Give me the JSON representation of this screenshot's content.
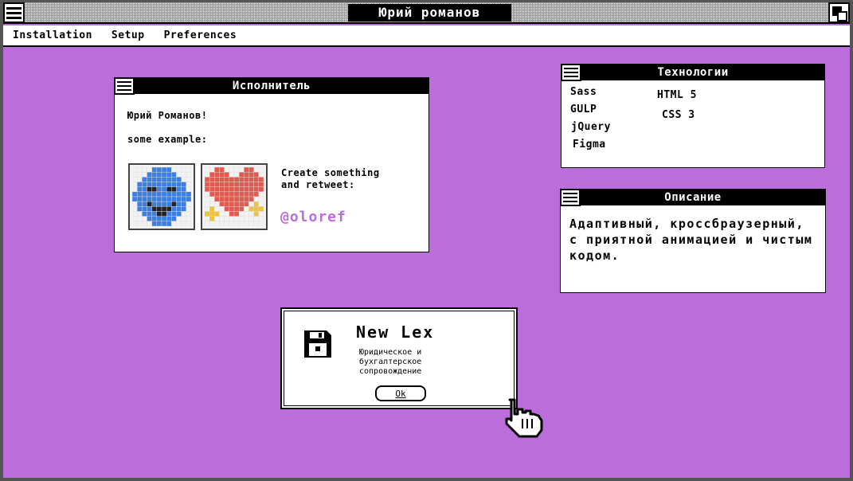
{
  "window": {
    "title": "Юрий романов"
  },
  "menu": [
    "Installation",
    "Setup",
    "Preferences"
  ],
  "artist_window": {
    "title": "Исполнитель",
    "name_line": "Юрий Романов!",
    "example_line": "some example:",
    "tweet_line1": "Create something",
    "tweet_line2": "and retweet:",
    "handle": "@oloref"
  },
  "tech_window": {
    "title": "Технологии",
    "items": [
      "Sass",
      "GULP",
      "jQuery",
      "Figma",
      "HTML 5",
      "CSS 3"
    ]
  },
  "desc_window": {
    "title": "Описание",
    "text": "Адаптивный, кроссбраузерный, с приятной анимацией и чистым кодом."
  },
  "dialog": {
    "title": "New Lex",
    "subtitle": "Юридическое и бухгалтерское сопровождение",
    "ok_label": "Ok"
  },
  "colors": {
    "desktop": "#bb6ddb",
    "accent": "#bb6ddb",
    "blue": "#3d7fe0",
    "red": "#e05a50",
    "yellow": "#f0c040"
  },
  "icons": [
    "system-menu-icon",
    "maximize-icon",
    "floppy-disk-icon",
    "hand-pointer-icon",
    "pixel-face-icon",
    "pixel-heart-icon"
  ]
}
